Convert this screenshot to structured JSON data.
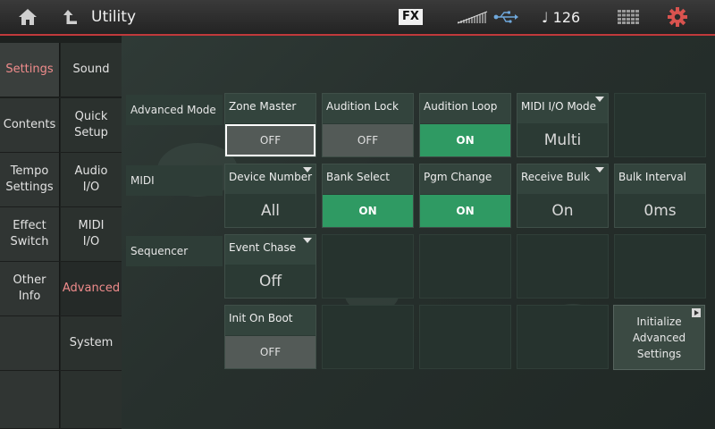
{
  "header": {
    "title": "Utility",
    "fx_label": "FX",
    "tempo": "126",
    "tempo_note_glyph": "♩",
    "icons": [
      "home-icon",
      "up-arrow-icon",
      "meter-icon",
      "usb-icon",
      "grid-icon",
      "gear-icon"
    ],
    "accent_color": "#c0393b"
  },
  "sidebar_primary": {
    "items": [
      {
        "label": "Settings",
        "active": true
      },
      {
        "label": "Contents",
        "active": false
      },
      {
        "label": "Tempo\nSettings",
        "active": false
      },
      {
        "label": "Effect\nSwitch",
        "active": false
      },
      {
        "label": "Other\nInfo",
        "active": false
      }
    ]
  },
  "sidebar_secondary": {
    "items": [
      {
        "label": "Sound",
        "active": false
      },
      {
        "label": "Quick\nSetup",
        "active": false
      },
      {
        "label": "Audio\nI/O",
        "active": false
      },
      {
        "label": "MIDI\nI/O",
        "active": false
      },
      {
        "label": "Advanced",
        "active": true
      },
      {
        "label": "System",
        "active": false
      }
    ]
  },
  "rows": {
    "advanced_mode": "Advanced Mode",
    "midi": "MIDI",
    "sequencer": "Sequencer"
  },
  "params": {
    "zone_master": {
      "label": "Zone Master",
      "value": "OFF"
    },
    "audition_lock": {
      "label": "Audition Lock",
      "value": "OFF"
    },
    "audition_loop": {
      "label": "Audition Loop",
      "value": "ON"
    },
    "midi_io_mode": {
      "label": "MIDI I/O Mode",
      "value": "Multi"
    },
    "device_number": {
      "label": "Device Number",
      "value": "All"
    },
    "bank_select": {
      "label": "Bank Select",
      "value": "ON"
    },
    "pgm_change": {
      "label": "Pgm Change",
      "value": "ON"
    },
    "receive_bulk": {
      "label": "Receive Bulk",
      "value": "On"
    },
    "bulk_interval": {
      "label": "Bulk Interval",
      "value": "0ms"
    },
    "event_chase": {
      "label": "Event Chase",
      "value": "Off"
    },
    "init_on_boot": {
      "label": "Init On Boot",
      "value": "OFF"
    }
  },
  "initialize_button": {
    "label": "Initialize\nAdvanced\nSettings"
  },
  "colors": {
    "on_green": "#2f9a63",
    "active_text": "#f08c8c"
  }
}
